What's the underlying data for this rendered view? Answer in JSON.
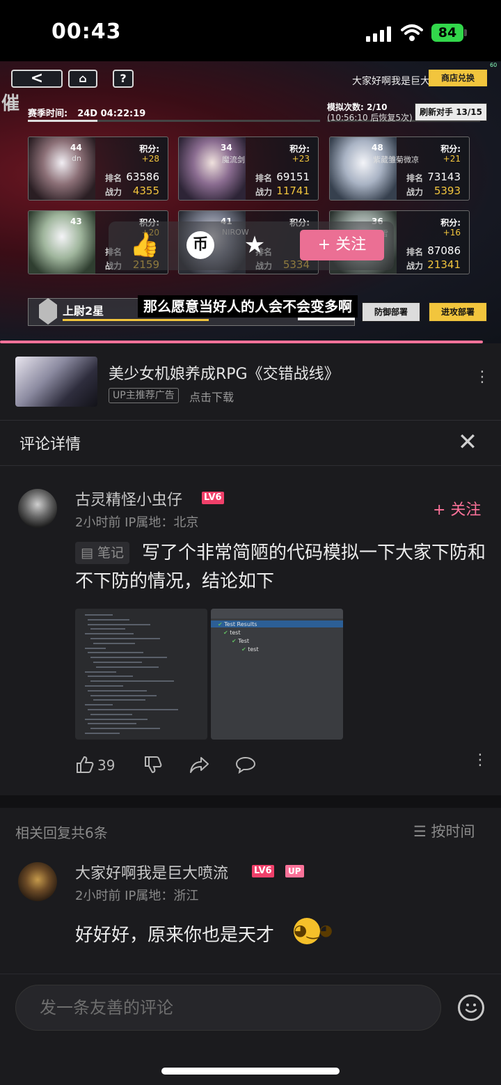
{
  "status_bar": {
    "time": "00:43",
    "battery": "84"
  },
  "video": {
    "game_ui": {
      "back": "<",
      "help": "?",
      "uploader_name": "大家好啊我是巨大喷流",
      "shop": "商店兑换",
      "cui": "催",
      "season_label": "赛季时间:",
      "season_value": "24D 04:22:19",
      "sim_label": "模拟次数:",
      "sim_value": "2/10",
      "sim_sub": "(10:56:10 后恢复5次)",
      "refresh": "刷新对手 13/15",
      "corner": "60",
      "cards": [
        {
          "lv": "44",
          "name": "dn",
          "score_label": "积分:",
          "score": "+28",
          "rank_label": "排名",
          "rank": "63586",
          "power_label": "战力",
          "power": "4355"
        },
        {
          "lv": "34",
          "name": "魔流剑",
          "score_label": "积分:",
          "score": "+23",
          "rank_label": "排名",
          "rank": "69151",
          "power_label": "战力",
          "power": "11741"
        },
        {
          "lv": "48",
          "name": "紫葳雏菊微凉",
          "score_label": "积分:",
          "score": "+21",
          "rank_label": "排名",
          "rank": "73143",
          "power_label": "战力",
          "power": "5393"
        },
        {
          "lv": "43",
          "name": "",
          "score_label": "积分:",
          "score": "+20",
          "rank_label": "排名",
          "rank": "",
          "power_label": "战力",
          "power": "2159"
        },
        {
          "lv": "41",
          "name": "NIROW",
          "score_label": "积分:",
          "score": "",
          "rank_label": "排名",
          "rank": "",
          "power_label": "战力",
          "power": "5334"
        },
        {
          "lv": "36",
          "name": "寒雪",
          "score_label": "积分:",
          "score": "+16",
          "rank_label": "排名",
          "rank": "87086",
          "power_label": "战力",
          "power": "21341"
        }
      ],
      "rank_title": "上尉2星",
      "defense": "防御部署",
      "attack": "进攻部署"
    },
    "overlay": {
      "follow": "+ 关注"
    },
    "subtitle": "那么愿意当好人的人会不会变多啊"
  },
  "ad": {
    "title": "美少女机娘养成RPG《交错战线》",
    "tag": "UP主推荐广告",
    "download": "点击下载"
  },
  "section_title": "评论详情",
  "comment": {
    "username": "古灵精怪小虫仔",
    "level": "LV6",
    "meta": "2小时前  IP属地：北京",
    "follow": "+ 关注",
    "note_tag": "笔记",
    "text": "写了个非常简陋的代码模拟一下大家下防和不下防的情况，结论如下",
    "test_panel": [
      "Test Results",
      "test",
      "Test",
      "test"
    ],
    "likes": "39"
  },
  "replies": {
    "count": "相关回复共6条",
    "sort": "按时间",
    "items": [
      {
        "username": "大家好啊我是巨大喷流",
        "level": "LV6",
        "badge": "UP",
        "meta": "2小时前  IP属地：浙江",
        "text": "好好好，原来你也是天才"
      }
    ]
  },
  "input": {
    "placeholder": "发一条友善的评论"
  },
  "colors": {
    "accent": "#fb7299",
    "level": "#f0406a",
    "battery": "#32d74b",
    "gold": "#f2c53d"
  }
}
